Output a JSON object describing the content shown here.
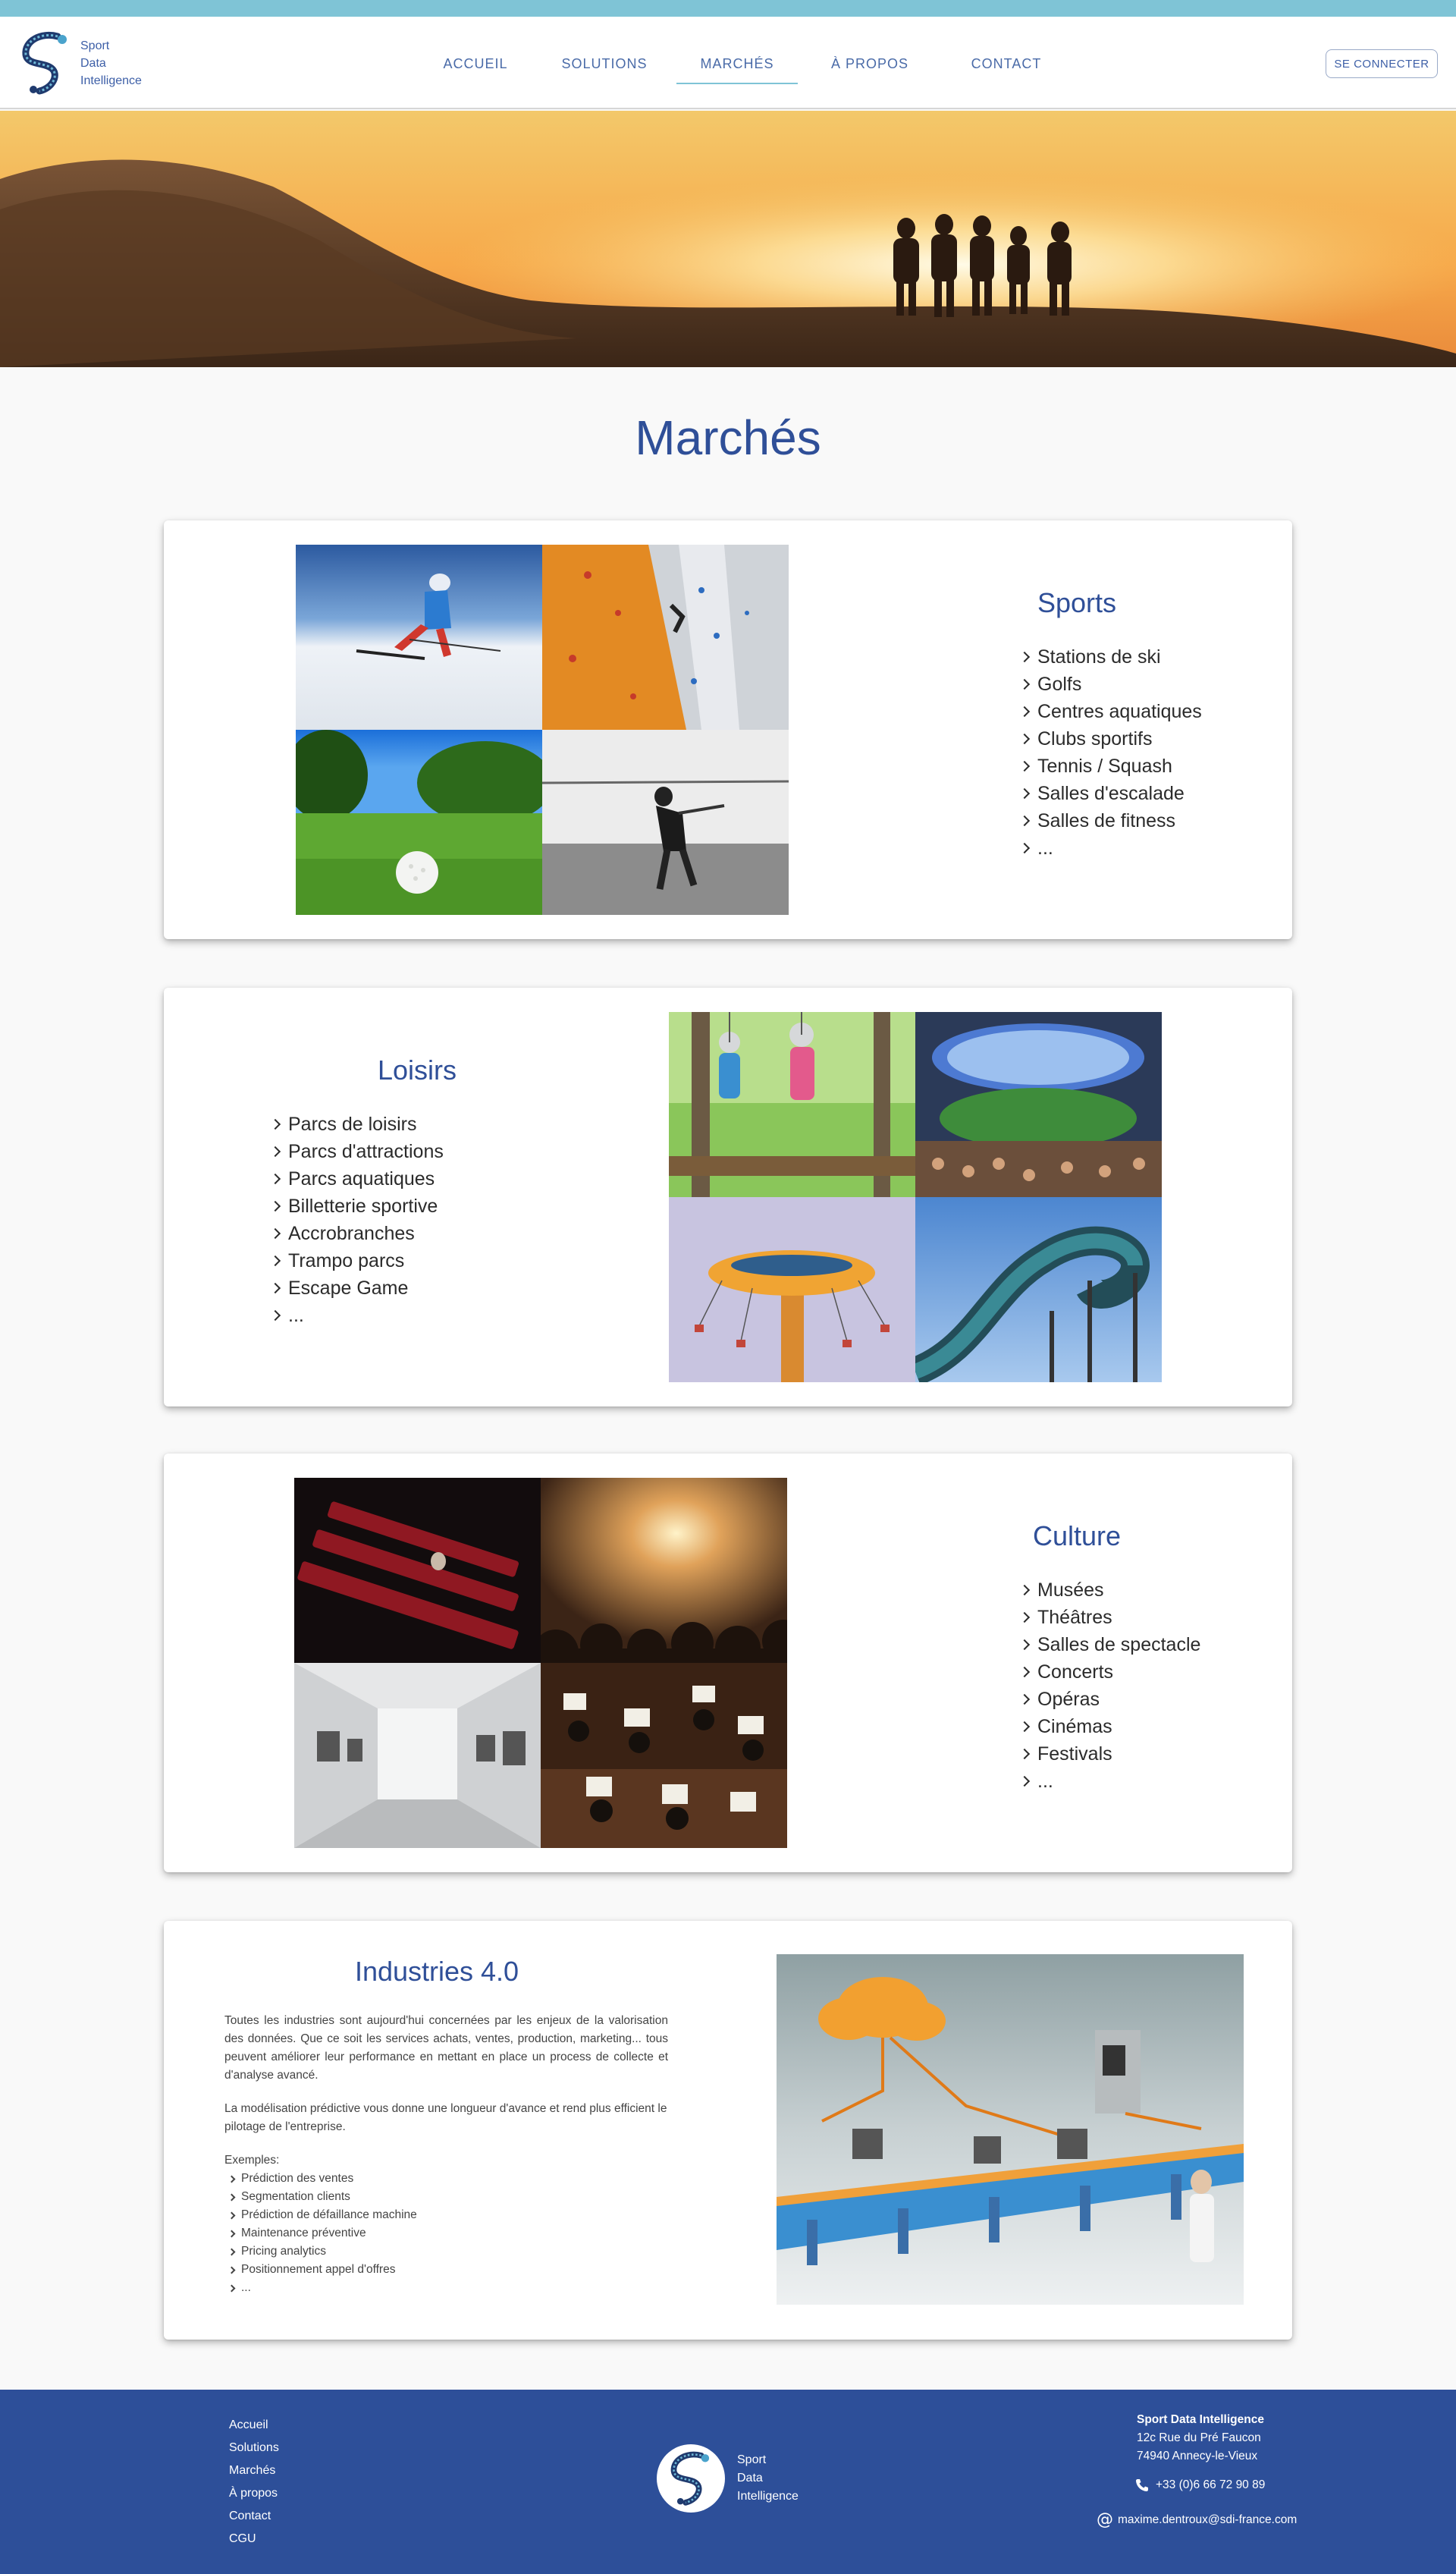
{
  "brand": {
    "logo_lines": [
      "Sport",
      "Data",
      "Intelligence"
    ]
  },
  "nav": {
    "items": [
      {
        "label": "Accueil",
        "active": false
      },
      {
        "label": "Solutions",
        "active": false
      },
      {
        "label": "Marchés",
        "active": true
      },
      {
        "label": "À propos",
        "active": false
      },
      {
        "label": "Contact",
        "active": false
      }
    ],
    "login_label": "Se connecter"
  },
  "page": {
    "title": "Marchés"
  },
  "sections": {
    "sports": {
      "title": "Sports",
      "items": [
        "Stations de ski",
        "Golfs",
        "Centres aquatiques",
        "Clubs sportifs",
        "Tennis / Squash",
        "Salles d'escalade",
        "Salles de fitness",
        "..."
      ]
    },
    "loisirs": {
      "title": "Loisirs",
      "items": [
        "Parcs de loisirs",
        "Parcs d'attractions",
        "Parcs aquatiques",
        "Billetterie sportive",
        "Accrobranches",
        "Trampo parcs",
        "Escape Game",
        "..."
      ]
    },
    "culture": {
      "title": "Culture",
      "items": [
        "Musées",
        "Théâtres",
        "Salles de spectacle",
        "Concerts",
        "Opéras",
        "Cinémas",
        "Festivals",
        "..."
      ]
    },
    "industries": {
      "title": "Industries 4.0",
      "paragraph1": "Toutes les industries sont aujourd'hui concernées par les enjeux de la valorisation des données. Que ce soit les services achats, ventes, production, marketing... tous peuvent améliorer leur performance en mettant en place un process de collecte et d'analyse avancé.",
      "paragraph2": "La modélisation prédictive vous donne une longueur d'avance et rend plus efficient le pilotage de l'entreprise.",
      "examples_label": "Exemples:",
      "items": [
        "Prédiction des ventes",
        "Segmentation clients",
        "Prédiction de défaillance machine",
        "Maintenance préventive",
        "Pricing analytics",
        "Positionnement appel d'offres",
        "..."
      ]
    }
  },
  "footer": {
    "links": [
      "Accueil",
      "Solutions",
      "Marchés",
      "À propos",
      "Contact",
      "CGU"
    ],
    "company": "Sport Data Intelligence",
    "address_line1": "12c Rue du Pré Faucon",
    "address_line2": "74940 Annecy-le-Vieux",
    "phone": "+33 (0)6 66 72 90 89",
    "email": "maxime.dentroux@sdi-france.com"
  },
  "colors": {
    "top_bar": "#7fc4d6",
    "accent": "#2f4f98",
    "footer_bg": "#2d4f99"
  }
}
